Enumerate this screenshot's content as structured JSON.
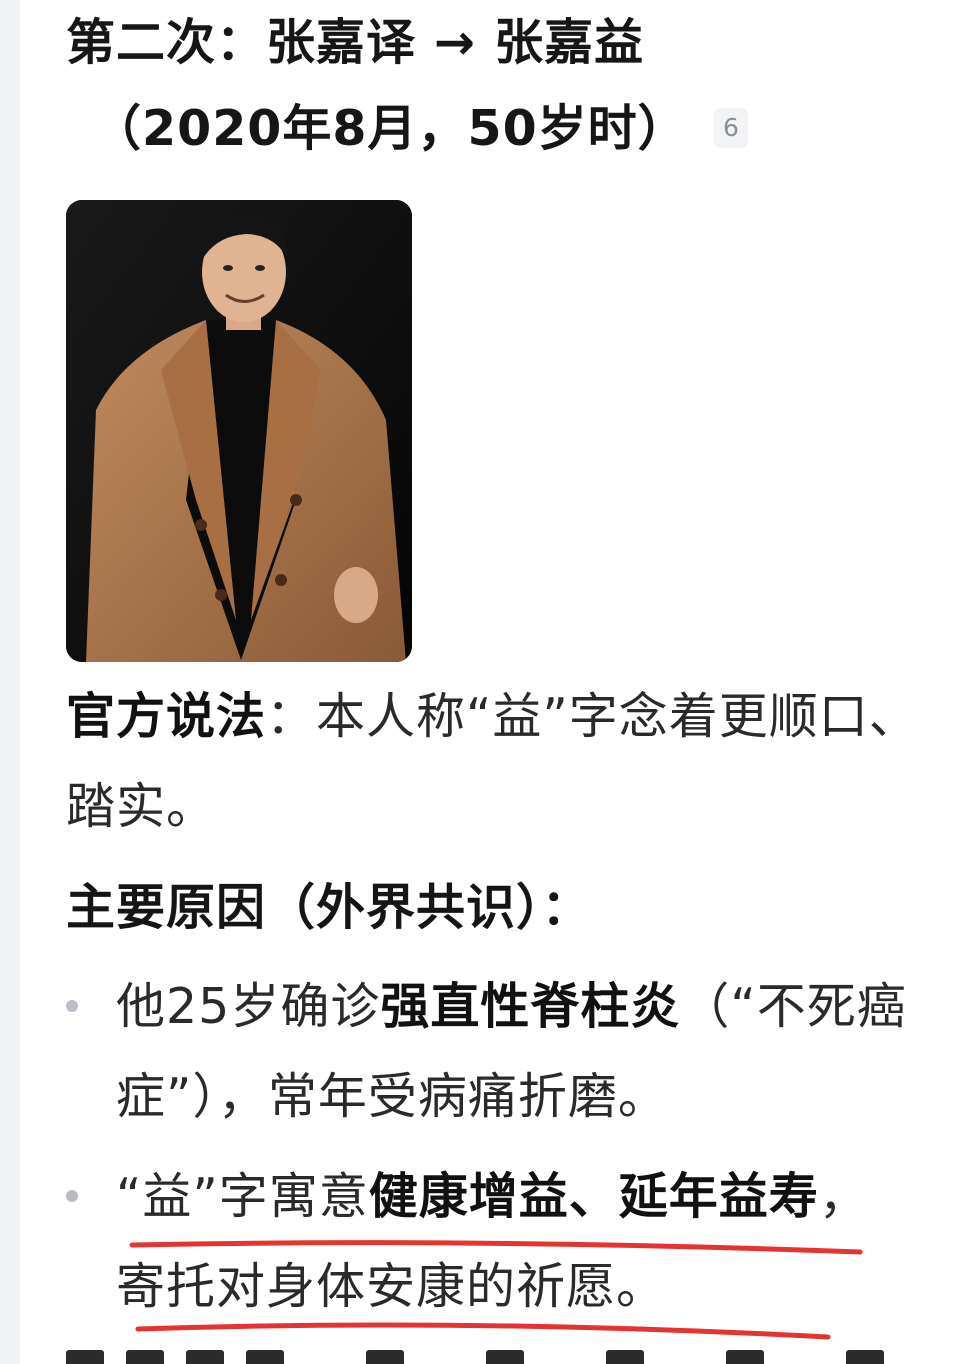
{
  "title": {
    "line1": "第二次：张嘉译 → 张嘉益",
    "line2": "（2020年8月，50岁时）",
    "ref_badge": "6"
  },
  "photo": {
    "alt": "man-in-camel-coat"
  },
  "official": {
    "label": "官方说法",
    "text": "：本人称“益”字念着更顺口、踏实。"
  },
  "reasons": {
    "heading": "主要原因（外界共识）：",
    "items": [
      {
        "before": "他25岁确诊",
        "bold": "强直性脊柱炎",
        "after": "（“不死癌症”），常年受病痛折磨。"
      },
      {
        "before": "“益”字寓意",
        "bold": "健康增益、延年益寿",
        "after": "，寄托对身体安康的祈愿。"
      }
    ]
  },
  "colors": {
    "underline_red": "#e3342f",
    "bullet_dot": "#b9bcc4"
  }
}
